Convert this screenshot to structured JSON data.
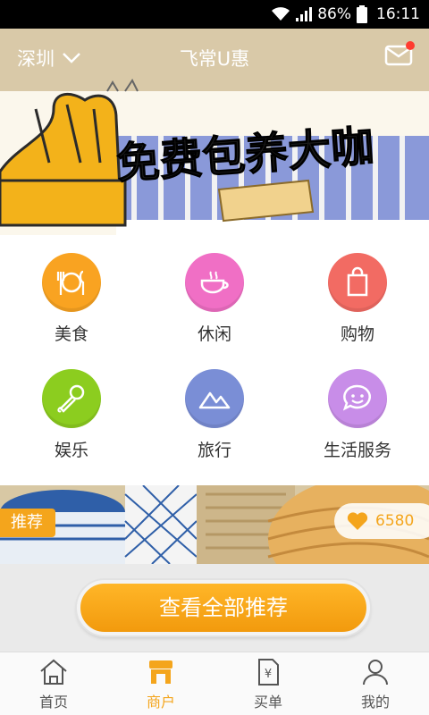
{
  "status_bar": {
    "battery": "86%",
    "time": "16:11"
  },
  "header": {
    "city": "深圳",
    "title": "飞常U惠",
    "has_unread": true
  },
  "banner": {
    "headline": "免费包养大咖"
  },
  "categories": [
    {
      "label": "美食",
      "icon": "cutlery-icon",
      "color": "#f9a321"
    },
    {
      "label": "休闲",
      "icon": "coffee-cup-icon",
      "color": "#f06fc5"
    },
    {
      "label": "购物",
      "icon": "shopping-bag-icon",
      "color": "#f26b63"
    },
    {
      "label": "娱乐",
      "icon": "microphone-icon",
      "color": "#8ccd1f"
    },
    {
      "label": "旅行",
      "icon": "mountain-icon",
      "color": "#7a8ed6"
    },
    {
      "label": "生活服务",
      "icon": "smiley-chat-icon",
      "color": "#c88de8"
    }
  ],
  "recommend": {
    "badge": "推荐",
    "likes": "6580"
  },
  "see_all": {
    "label": "查看全部推荐"
  },
  "tabs": [
    {
      "label": "首页",
      "icon": "home-icon",
      "active": false
    },
    {
      "label": "商户",
      "icon": "store-icon",
      "active": true
    },
    {
      "label": "买单",
      "icon": "bill-icon",
      "active": false
    },
    {
      "label": "我的",
      "icon": "user-icon",
      "active": false
    }
  ]
}
